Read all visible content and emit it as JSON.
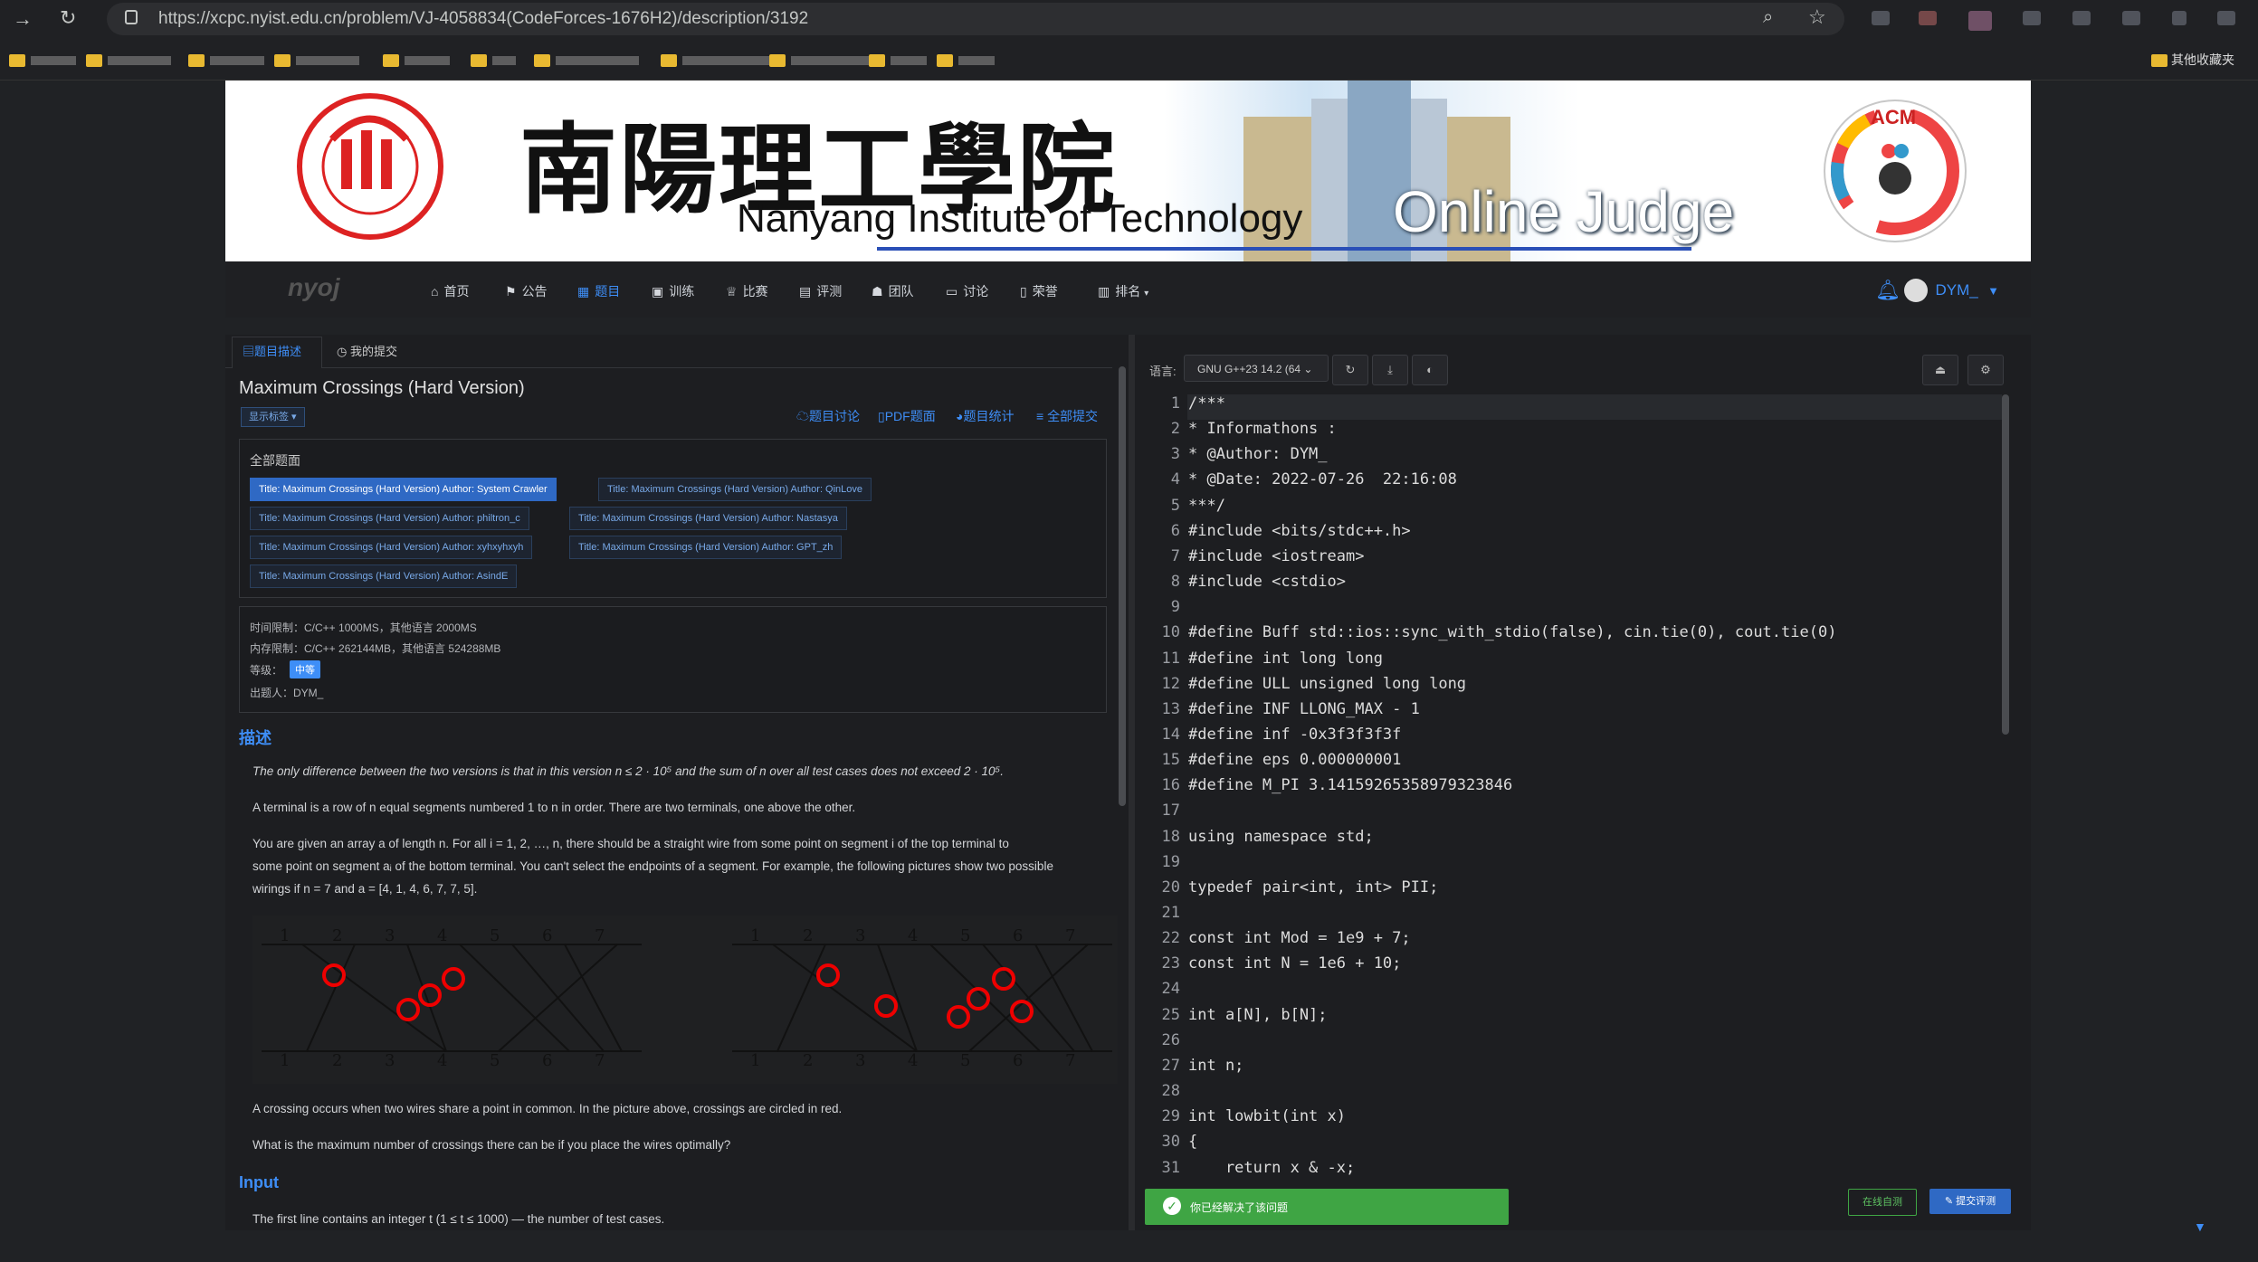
{
  "browser": {
    "url": "https://xcpc.nyist.edu.cn/problem/VJ-4058834(CodeForces-1676H2)/description/3192",
    "bookmarks_other": "其他收藏夹"
  },
  "banner": {
    "school_cn": "南陽理工學院",
    "school_en": "Nanyang Institute of Technology",
    "oj": "Online Judge",
    "acm": "ACM"
  },
  "nav": {
    "logo": "nyoj",
    "items": [
      "首页",
      "公告",
      "题目",
      "训练",
      "比赛",
      "评测",
      "团队",
      "讨论",
      "荣誉",
      "排名"
    ],
    "user": "DYM_"
  },
  "left": {
    "tab_desc": "题目描述",
    "tab_submissions": "我的提交",
    "problem_title": "Maximum Crossings (Hard Version)",
    "show_tags": "显示标签",
    "links": [
      "题目讨论",
      "PDF题面",
      "题目统计",
      "全部提交"
    ],
    "all_statements": "全部题面",
    "statements": [
      "Title: Maximum Crossings (Hard Version) Author: System Crawler",
      "Title: Maximum Crossings (Hard Version) Author: QinLove",
      "Title: Maximum Crossings (Hard Version) Author: philtron_c",
      "Title: Maximum Crossings (Hard Version) Author: Nastasya",
      "Title: Maximum Crossings (Hard Version) Author: xyhxyhxyh",
      "Title: Maximum Crossings (Hard Version) Author: GPT_zh",
      "Title: Maximum Crossings (Hard Version) Author: AsindE"
    ],
    "time_limit": "时间限制：C/C++ 1000MS，其他语言 2000MS",
    "memory_limit": "内存限制：C/C++ 262144MB，其他语言 524288MB",
    "level_label": "等级：",
    "level_value": "中等",
    "setter": "出题人：DYM_",
    "sec_desc": "描述",
    "p1": "The only difference between the two versions is that in this version n ≤ 2 · 10⁵ and the sum of n over all test cases does not exceed 2 · 10⁵.",
    "p2": "A terminal is a row of n equal segments numbered 1 to n in order. There are two terminals, one above the other.",
    "p3a": "You are given an array a of length n. For all i = 1, 2, …, n, there should be a straight wire from some point on segment i of the top terminal to",
    "p3b": "some point on segment aᵢ of the bottom terminal. You can't select the endpoints of a segment. For example, the following pictures show two possible",
    "p3c": "wirings if n = 7 and a = [4, 1, 4, 6, 7, 7, 5].",
    "p4": "A crossing occurs when two wires share a point in common. In the picture above, crossings are circled in red.",
    "p5": "What is the maximum number of crossings there can be if you place the wires optimally?",
    "sec_input": "Input",
    "p6": "The first line contains an integer t (1 ≤ t ≤ 1000) — the number of test cases.",
    "terminal_numbers": [
      "1",
      "2",
      "3",
      "4",
      "5",
      "6",
      "7"
    ]
  },
  "right": {
    "lang_label": "语言:",
    "lang_value": "GNU G++23 14.2 (64",
    "code_lines": [
      "/***",
      "* Informathons :",
      "* @Author: DYM_",
      "* @Date: 2022-07-26  22:16:08",
      "***/",
      "#include <bits/stdc++.h>",
      "#include <iostream>",
      "#include <cstdio>",
      "",
      "#define Buff std::ios::sync_with_stdio(false), cin.tie(0), cout.tie(0)",
      "#define int long long",
      "#define ULL unsigned long long",
      "#define INF LLONG_MAX - 1",
      "#define inf -0x3f3f3f3f",
      "#define eps 0.000000001",
      "#define M_PI 3.14159265358979323846",
      "",
      "using namespace std;",
      "",
      "typedef pair<int, int> PII;",
      "",
      "const int Mod = 1e9 + 7;",
      "const int N = 1e6 + 10;",
      "",
      "int a[N], b[N];",
      "",
      "int n;",
      "",
      "int lowbit(int x)",
      "{",
      "    return x & -x;"
    ],
    "solved_msg": "你已经解决了该问题",
    "btn_selftest": "在线自测",
    "btn_submit": "提交评测"
  }
}
